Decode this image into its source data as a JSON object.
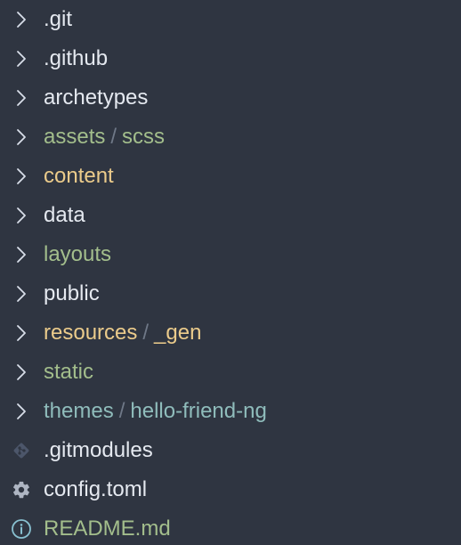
{
  "colors": {
    "background": "#2f3541",
    "chevron": "#d8dee9",
    "default": "#e5e9f0",
    "green": "#a3be8c",
    "yellow": "#ebcb8b",
    "teal": "#8fbcbb",
    "blue": "#88c0d0",
    "separator": "#6f7887",
    "gear": "#aeb5c2",
    "git": "#4c566a"
  },
  "items": [
    {
      "icon": "chevron-right-icon",
      "name": ".git",
      "color": "#e5e9f0"
    },
    {
      "icon": "chevron-right-icon",
      "name": ".github",
      "color": "#e5e9f0"
    },
    {
      "icon": "chevron-right-icon",
      "name": "archetypes",
      "color": "#e5e9f0"
    },
    {
      "icon": "chevron-right-icon",
      "name": "assets",
      "sub": "scss",
      "color": "#a3be8c"
    },
    {
      "icon": "chevron-right-icon",
      "name": "content",
      "color": "#ebcb8b"
    },
    {
      "icon": "chevron-right-icon",
      "name": "data",
      "color": "#e5e9f0"
    },
    {
      "icon": "chevron-right-icon",
      "name": "layouts",
      "color": "#a3be8c"
    },
    {
      "icon": "chevron-right-icon",
      "name": "public",
      "color": "#e5e9f0"
    },
    {
      "icon": "chevron-right-icon",
      "name": "resources",
      "sub": "_gen",
      "color": "#ebcb8b"
    },
    {
      "icon": "chevron-right-icon",
      "name": "static",
      "color": "#a3be8c"
    },
    {
      "icon": "chevron-right-icon",
      "name": "themes",
      "sub": "hello-friend-ng",
      "color": "#8fbcbb"
    },
    {
      "icon": "git-icon",
      "name": ".gitmodules",
      "color": "#e5e9f0"
    },
    {
      "icon": "gear-icon",
      "name": "config.toml",
      "color": "#e5e9f0"
    },
    {
      "icon": "info-icon",
      "name": "README.md",
      "color": "#a3be8c"
    }
  ]
}
